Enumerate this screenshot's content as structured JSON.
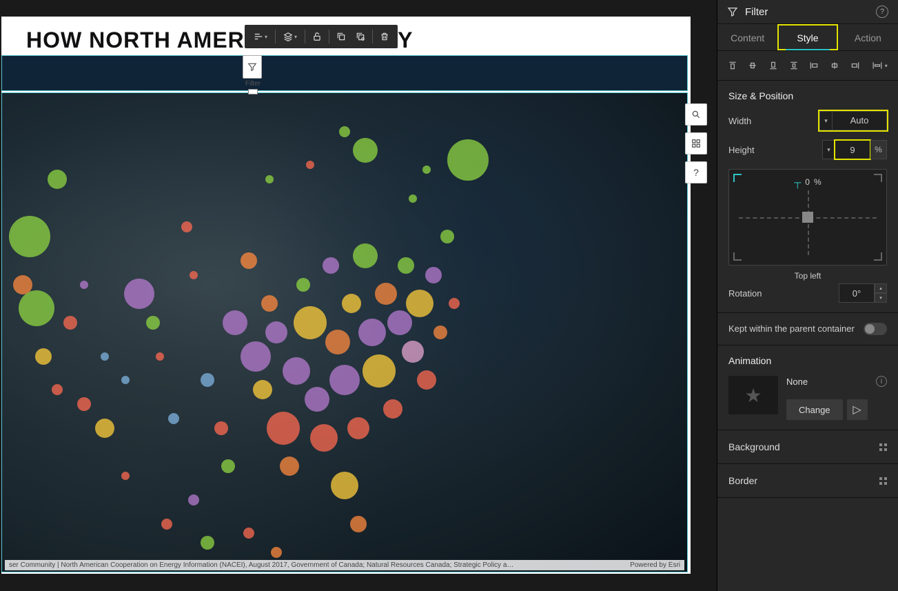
{
  "canvas": {
    "title": "HOW NORTH AMERICA                   ECTRICITY",
    "attribution_left": "ser Community | North American Cooperation on Energy Information (NACEI), August 2017, Government of Canada; Natural Resources Canada; Strategic Policy a…",
    "attribution_right": "Powered by Esri"
  },
  "filterWidget": {
    "label": "Filter"
  },
  "floatingToolbar": {
    "items": [
      "align-icon",
      "layers-icon",
      "unlock-icon",
      "duplicate-icon",
      "duplicate-settings-icon",
      "delete-icon"
    ]
  },
  "mapTools": {
    "search": "search-icon",
    "legend": "legend-grid-icon",
    "help": "?"
  },
  "rightPanel": {
    "header": {
      "title": "Filter"
    },
    "tabs": {
      "content": "Content",
      "style": "Style",
      "action": "Action",
      "active": "style"
    },
    "sizePosition": {
      "title": "Size & Position",
      "widthLabel": "Width",
      "widthValue": "Auto",
      "heightLabel": "Height",
      "heightValue": "9",
      "heightUnit": "%",
      "topOffsetValue": "0",
      "topOffsetUnit": "%",
      "anchorLabel": "Top left",
      "rotationLabel": "Rotation",
      "rotationValue": "0°"
    },
    "keepWithin": {
      "label": "Kept within the parent container",
      "value": false
    },
    "animation": {
      "title": "Animation",
      "name": "None",
      "changeLabel": "Change"
    },
    "background": {
      "label": "Background"
    },
    "border": {
      "label": "Border"
    }
  },
  "bubbles": [
    {
      "x": 4,
      "y": 30,
      "r": 30,
      "c": "#8fd641"
    },
    {
      "x": 8,
      "y": 18,
      "r": 14,
      "c": "#8fd641"
    },
    {
      "x": 5,
      "y": 45,
      "r": 26,
      "c": "#8fd641"
    },
    {
      "x": 3,
      "y": 40,
      "r": 14,
      "c": "#ff8a3d"
    },
    {
      "x": 10,
      "y": 48,
      "r": 10,
      "c": "#ff6a50"
    },
    {
      "x": 6,
      "y": 55,
      "r": 12,
      "c": "#ffce3a"
    },
    {
      "x": 8,
      "y": 62,
      "r": 8,
      "c": "#ff6a50"
    },
    {
      "x": 12,
      "y": 65,
      "r": 10,
      "c": "#ff6a50"
    },
    {
      "x": 15,
      "y": 70,
      "r": 14,
      "c": "#ffce3a"
    },
    {
      "x": 12,
      "y": 40,
      "r": 6,
      "c": "#b77bd0"
    },
    {
      "x": 15,
      "y": 55,
      "r": 6,
      "c": "#7fb3e0"
    },
    {
      "x": 18,
      "y": 60,
      "r": 6,
      "c": "#7fb3e0"
    },
    {
      "x": 20,
      "y": 42,
      "r": 22,
      "c": "#b77bd0"
    },
    {
      "x": 22,
      "y": 48,
      "r": 10,
      "c": "#8fd641"
    },
    {
      "x": 23,
      "y": 55,
      "r": 6,
      "c": "#ff6a50"
    },
    {
      "x": 25,
      "y": 68,
      "r": 8,
      "c": "#7fb3e0"
    },
    {
      "x": 27,
      "y": 28,
      "r": 8,
      "c": "#ff6a50"
    },
    {
      "x": 28,
      "y": 38,
      "r": 6,
      "c": "#ff6a50"
    },
    {
      "x": 30,
      "y": 60,
      "r": 10,
      "c": "#7fb3e0"
    },
    {
      "x": 32,
      "y": 70,
      "r": 10,
      "c": "#ff6a50"
    },
    {
      "x": 33,
      "y": 78,
      "r": 10,
      "c": "#8fd641"
    },
    {
      "x": 28,
      "y": 85,
      "r": 8,
      "c": "#b77bd0"
    },
    {
      "x": 34,
      "y": 48,
      "r": 18,
      "c": "#b77bd0"
    },
    {
      "x": 36,
      "y": 35,
      "r": 12,
      "c": "#ff8a3d"
    },
    {
      "x": 37,
      "y": 55,
      "r": 22,
      "c": "#b77bd0"
    },
    {
      "x": 38,
      "y": 62,
      "r": 14,
      "c": "#ffce3a"
    },
    {
      "x": 39,
      "y": 44,
      "r": 12,
      "c": "#ff8a3d"
    },
    {
      "x": 40,
      "y": 50,
      "r": 16,
      "c": "#b77bd0"
    },
    {
      "x": 41,
      "y": 70,
      "r": 24,
      "c": "#ff6a50"
    },
    {
      "x": 42,
      "y": 78,
      "r": 14,
      "c": "#ff8a3d"
    },
    {
      "x": 43,
      "y": 58,
      "r": 20,
      "c": "#b77bd0"
    },
    {
      "x": 44,
      "y": 40,
      "r": 10,
      "c": "#8fd641"
    },
    {
      "x": 45,
      "y": 48,
      "r": 24,
      "c": "#ffce3a"
    },
    {
      "x": 46,
      "y": 64,
      "r": 18,
      "c": "#b77bd0"
    },
    {
      "x": 47,
      "y": 72,
      "r": 20,
      "c": "#ff6a50"
    },
    {
      "x": 48,
      "y": 36,
      "r": 12,
      "c": "#b77bd0"
    },
    {
      "x": 49,
      "y": 52,
      "r": 18,
      "c": "#ff8a3d"
    },
    {
      "x": 50,
      "y": 60,
      "r": 22,
      "c": "#b77bd0"
    },
    {
      "x": 51,
      "y": 44,
      "r": 14,
      "c": "#ffce3a"
    },
    {
      "x": 52,
      "y": 70,
      "r": 16,
      "c": "#ff6a50"
    },
    {
      "x": 50,
      "y": 82,
      "r": 20,
      "c": "#ffce3a"
    },
    {
      "x": 52,
      "y": 90,
      "r": 12,
      "c": "#ff8a3d"
    },
    {
      "x": 53,
      "y": 34,
      "r": 18,
      "c": "#8fd641"
    },
    {
      "x": 54,
      "y": 50,
      "r": 20,
      "c": "#b77bd0"
    },
    {
      "x": 55,
      "y": 58,
      "r": 24,
      "c": "#ffce3a"
    },
    {
      "x": 56,
      "y": 42,
      "r": 16,
      "c": "#ff8a3d"
    },
    {
      "x": 57,
      "y": 66,
      "r": 14,
      "c": "#ff6a50"
    },
    {
      "x": 58,
      "y": 48,
      "r": 18,
      "c": "#b77bd0"
    },
    {
      "x": 59,
      "y": 36,
      "r": 12,
      "c": "#8fd641"
    },
    {
      "x": 60,
      "y": 54,
      "r": 16,
      "c": "#e6a6d0"
    },
    {
      "x": 61,
      "y": 44,
      "r": 20,
      "c": "#ffce3a"
    },
    {
      "x": 62,
      "y": 60,
      "r": 14,
      "c": "#ff6a50"
    },
    {
      "x": 63,
      "y": 38,
      "r": 12,
      "c": "#b77bd0"
    },
    {
      "x": 64,
      "y": 50,
      "r": 10,
      "c": "#ff8a3d"
    },
    {
      "x": 65,
      "y": 30,
      "r": 10,
      "c": "#8fd641"
    },
    {
      "x": 66,
      "y": 44,
      "r": 8,
      "c": "#ff6a50"
    },
    {
      "x": 60,
      "y": 22,
      "r": 6,
      "c": "#8fd641"
    },
    {
      "x": 62,
      "y": 16,
      "r": 6,
      "c": "#8fd641"
    },
    {
      "x": 53,
      "y": 12,
      "r": 18,
      "c": "#8fd641"
    },
    {
      "x": 50,
      "y": 8,
      "r": 8,
      "c": "#8fd641"
    },
    {
      "x": 45,
      "y": 15,
      "r": 6,
      "c": "#ff6a50"
    },
    {
      "x": 39,
      "y": 18,
      "r": 6,
      "c": "#8fd641"
    },
    {
      "x": 68,
      "y": 14,
      "r": 30,
      "c": "#8fd641"
    },
    {
      "x": 30,
      "y": 94,
      "r": 10,
      "c": "#8fd641"
    },
    {
      "x": 24,
      "y": 90,
      "r": 8,
      "c": "#ff6a50"
    },
    {
      "x": 36,
      "y": 92,
      "r": 8,
      "c": "#ff6a50"
    },
    {
      "x": 40,
      "y": 96,
      "r": 8,
      "c": "#ff8a3d"
    },
    {
      "x": 18,
      "y": 80,
      "r": 6,
      "c": "#ff6a50"
    }
  ]
}
